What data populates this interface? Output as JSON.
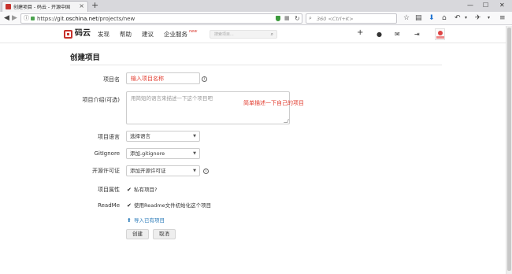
{
  "browser": {
    "tab_title": "创建项目 - 码云 - 开源中国",
    "tab_close": "×",
    "new_tab": "+",
    "window_buttons": [
      "—",
      "☐",
      "✕"
    ],
    "url_prefix": "https://git.",
    "url_domain": "oschina.net",
    "url_path": "/projects/new",
    "search_placeholder": "360 <Ctrl+K>",
    "toolbar_icons": [
      "star-icon",
      "reading-list-icon",
      "download-icon",
      "home-icon",
      "undo-icon",
      "extension-icon",
      "menu-icon"
    ]
  },
  "site": {
    "logo_text": "码云",
    "nav": [
      "发现",
      "帮助",
      "建议",
      "企业服务"
    ],
    "nav_badge": "new",
    "search_placeholder": "搜索项目..."
  },
  "form": {
    "title": "创建项目",
    "labels": {
      "name": "项目名",
      "description": "项目介绍(可选)",
      "language": "项目语言",
      "gitignore": "GitIgnore",
      "license": "开源许可证",
      "attribute": "项目属性",
      "readme": "ReadMe"
    },
    "name_annotation": "输入项目名称",
    "description_placeholder": "用简短的语言来描述一下这个项目吧",
    "description_annotation": "简单描述一下自己的项目",
    "language_value": "选择语言",
    "gitignore_value": "添加.gitignore",
    "license_value": "添加开源许可证",
    "private_checkbox": "私有项目?",
    "readme_checkbox": "使用Readme文件初始化这个项目",
    "import_link": "导入已有项目",
    "create_button": "创建",
    "cancel_button": "取消",
    "check_mark": "✔",
    "info_glyph": "i"
  }
}
